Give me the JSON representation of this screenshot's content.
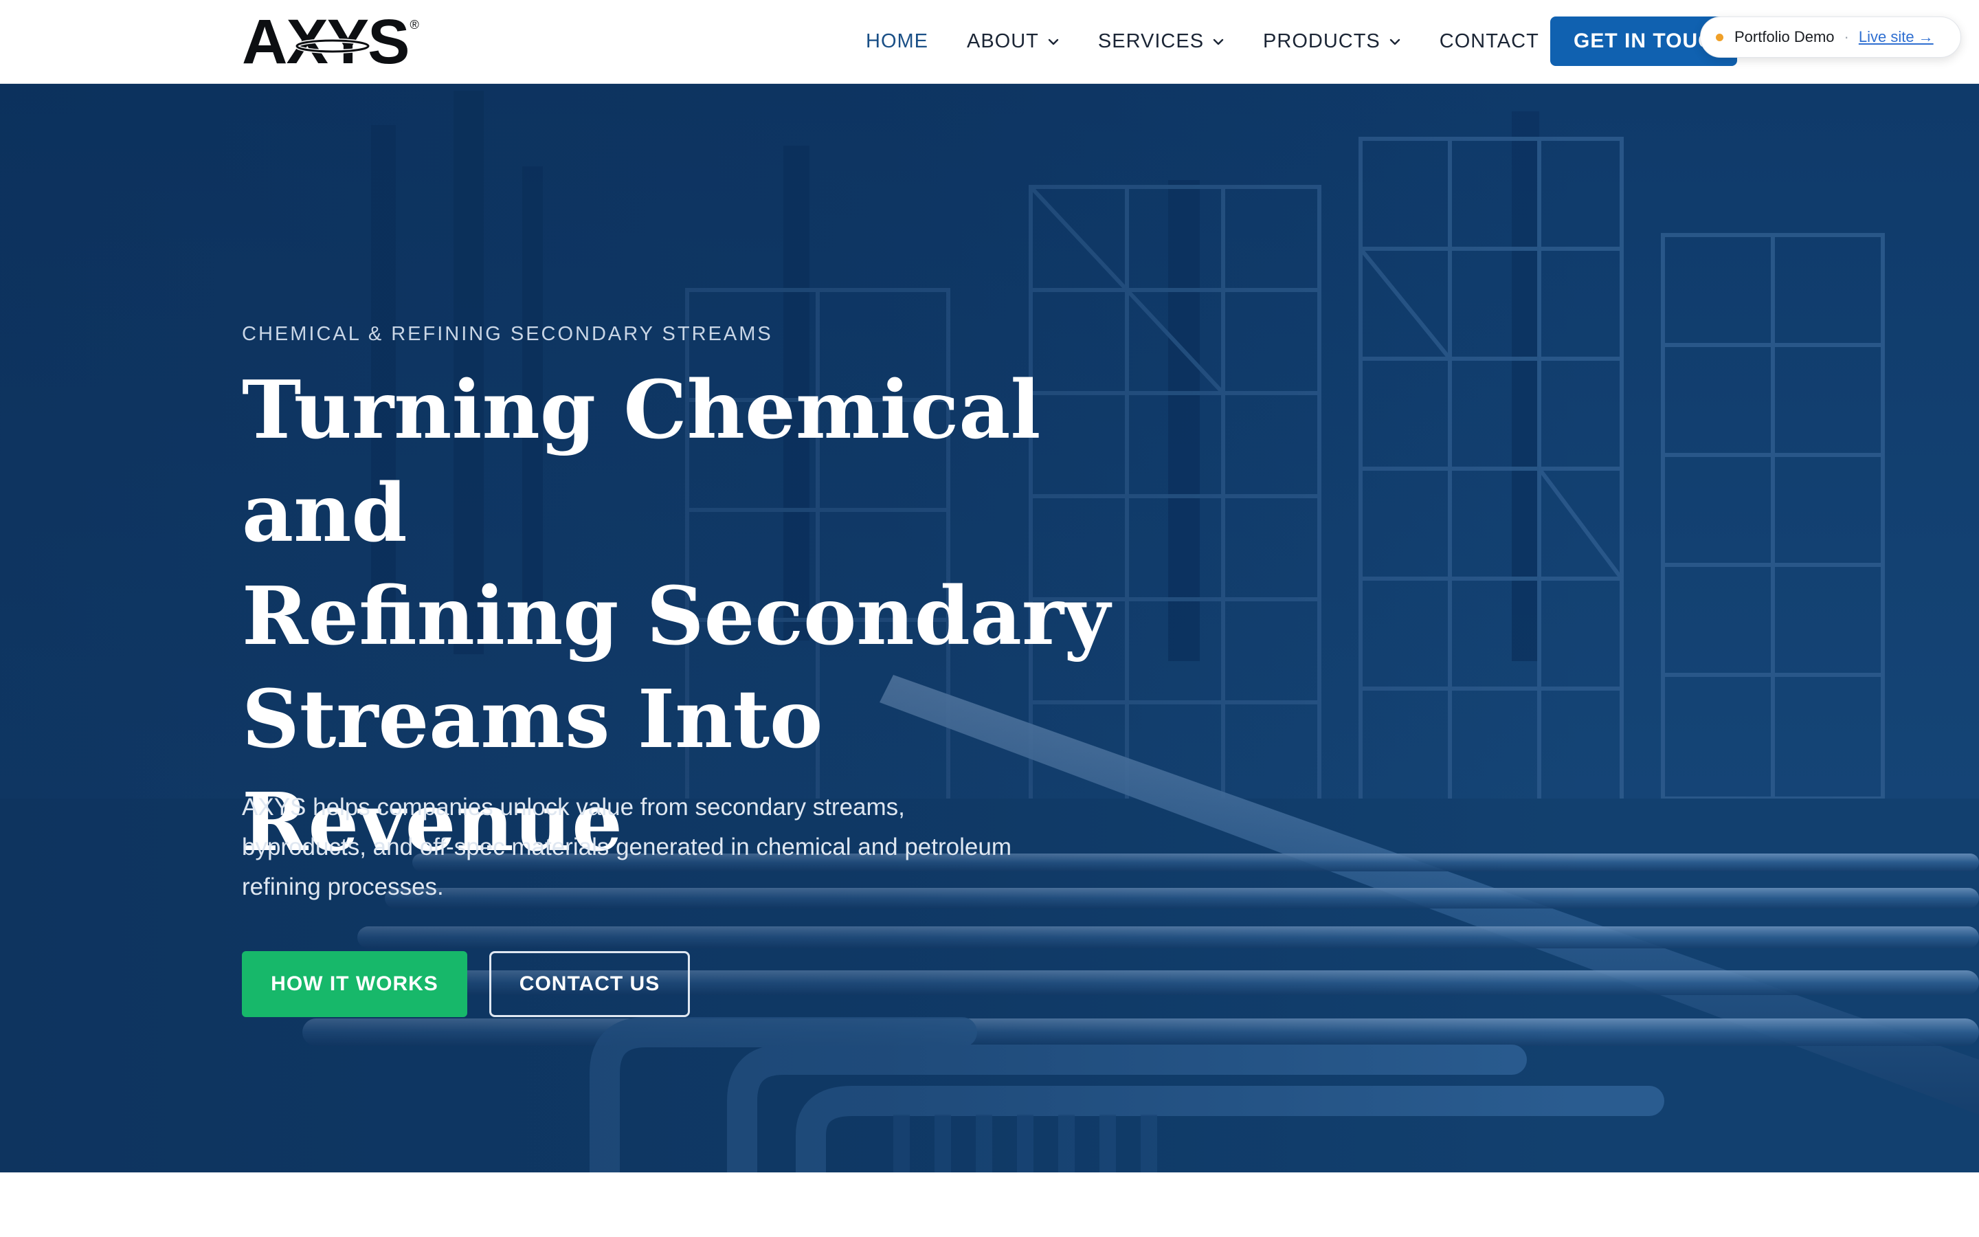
{
  "brand": {
    "logo_text": "AXYS",
    "logo_mark": "®"
  },
  "nav": {
    "items": [
      {
        "label": "HOME",
        "active": true,
        "dropdown": false
      },
      {
        "label": "ABOUT",
        "active": false,
        "dropdown": true
      },
      {
        "label": "SERVICES",
        "active": false,
        "dropdown": true
      },
      {
        "label": "PRODUCTS",
        "active": false,
        "dropdown": true
      },
      {
        "label": "CONTACT",
        "active": false,
        "dropdown": false
      }
    ],
    "cta_label": "GET IN TOUCH"
  },
  "demo_badge": {
    "label": "Portfolio Demo",
    "separator": "·",
    "link_label": "Live site →"
  },
  "hero": {
    "eyebrow": "CHEMICAL & REFINING SECONDARY STREAMS",
    "headline_lines": [
      "Turning Chemical and",
      "Refining Secondary",
      "Streams Into Revenue"
    ],
    "lead": "AXYS helps companies unlock value from secondary streams, byproducts, and off-spec materials generated in chemical and petroleum refining processes.",
    "primary_cta": "HOW IT WORKS",
    "secondary_cta": "CONTACT US"
  },
  "colors": {
    "nav_active": "#1a4f86",
    "cta_blue": "#1061b0",
    "hero_overlay": "#0e3a6a",
    "primary_green": "#17b86a",
    "badge_dot": "#f0a028"
  },
  "icons": {
    "nav_dropdown": "chevron-down-icon",
    "badge_status": "status-dot-icon"
  }
}
